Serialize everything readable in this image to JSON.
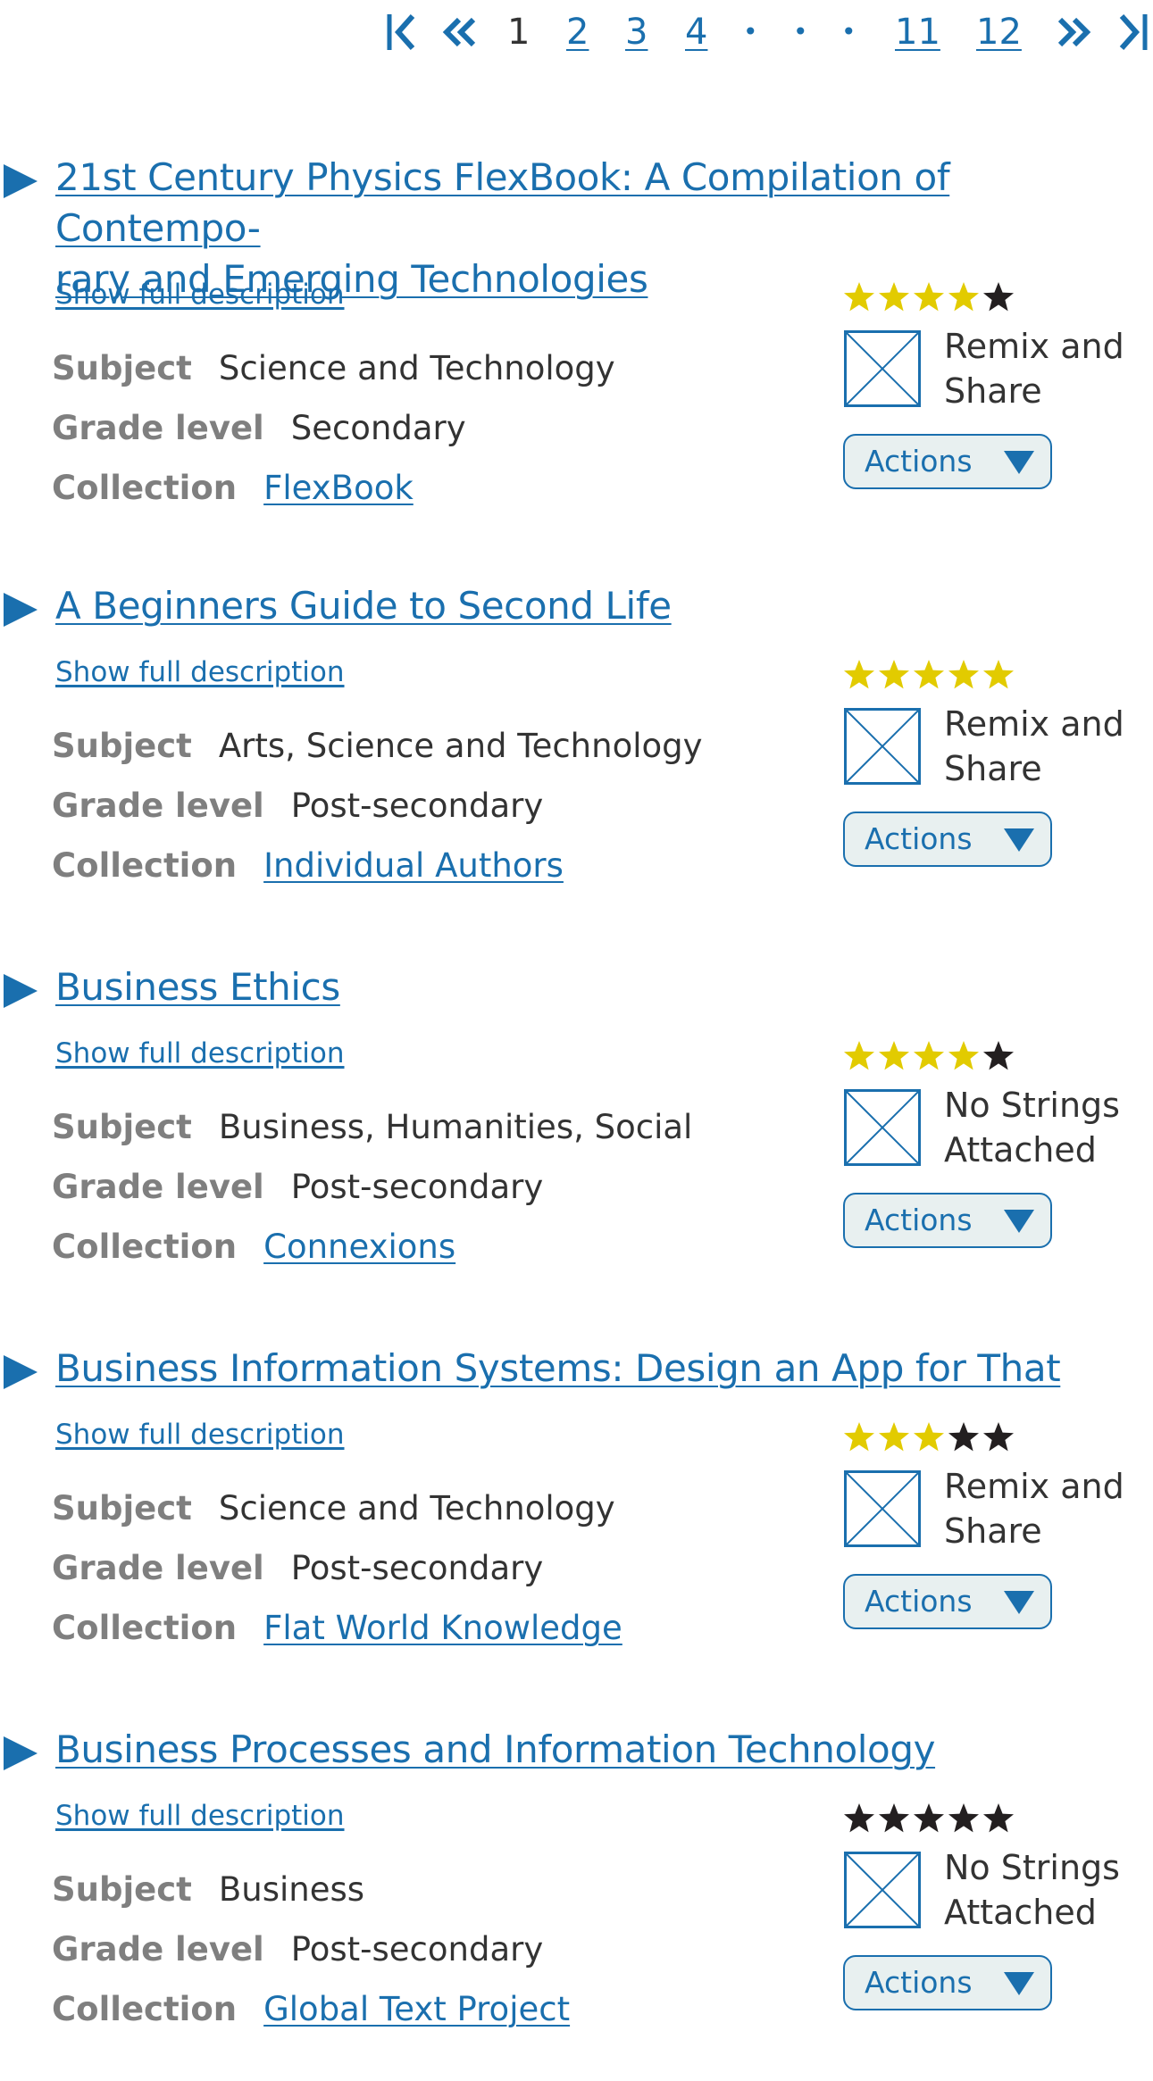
{
  "pagination": {
    "first_icon": "first-page-icon",
    "prev_icon": "double-chevron-left-icon",
    "pages": [
      "1",
      "2",
      "3",
      "4"
    ],
    "current": "1",
    "ellipsis": [
      "•",
      "•",
      "•"
    ],
    "tail_pages": [
      "11",
      "12"
    ],
    "next_icon": "double-chevron-right-icon",
    "last_icon": "last-page-icon"
  },
  "labels": {
    "subject": "Subject",
    "grade": "Grade level",
    "collection": "Collection",
    "show_desc": "Show full description",
    "actions": "Actions"
  },
  "colors": {
    "link": "#1a6fae",
    "star_filled": "#e2cb00",
    "star_empty": "#231f20",
    "label_gray": "#7f7f7f"
  },
  "resources": [
    {
      "title": "21st Century Physics FlexBook: A Compilation of Contempo-rary and Emerging Technologies",
      "title_line1": "21st Century Physics FlexBook: A Compilation of Contempo-",
      "title_line2": "rary and Emerging Technologies",
      "subject": "Science and Technology",
      "grade": "Secondary",
      "collection": "FlexBook",
      "rating": 4,
      "license_line1": "Remix and",
      "license_line2": "Share"
    },
    {
      "title": "A Beginners Guide to Second Life",
      "subject": "Arts, Science and Technology",
      "grade": "Post-secondary",
      "collection": "Individual Authors",
      "rating": 5,
      "license_line1": "Remix and",
      "license_line2": "Share"
    },
    {
      "title": "Business Ethics",
      "subject": "Business, Humanities, Social",
      "grade": "Post-secondary",
      "collection": "Connexions",
      "rating": 4,
      "license_line1": "No Strings",
      "license_line2": "Attached"
    },
    {
      "title": "Business Information Systems: Design an App for That",
      "subject": "Science and Technology",
      "grade": "Post-secondary",
      "collection": "Flat World Knowledge",
      "rating": 3,
      "license_line1": "Remix and",
      "license_line2": "Share"
    },
    {
      "title": "Business Processes and Information Technology",
      "subject": "Business",
      "grade": "Post-secondary",
      "collection": "Global Text Project",
      "rating": 0,
      "license_line1": "No Strings",
      "license_line2": "Attached"
    }
  ]
}
